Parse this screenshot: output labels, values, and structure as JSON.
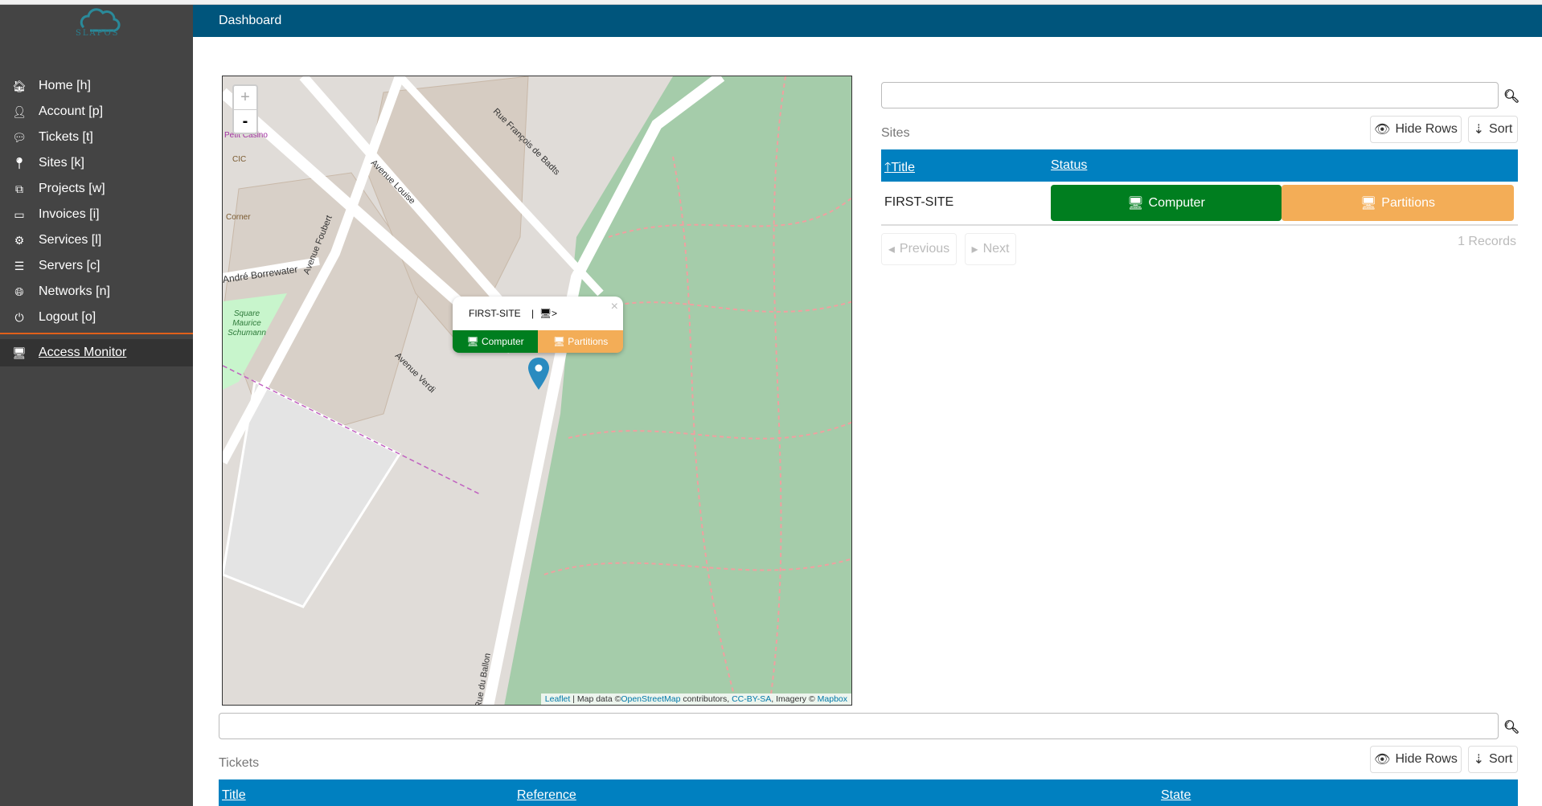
{
  "app": {
    "logo_text": "SLAPOS",
    "header_title": "Dashboard"
  },
  "sidebar": {
    "items": [
      {
        "label": "Home [h]",
        "icon": "home-icon"
      },
      {
        "label": "Account [p]",
        "icon": "user-icon"
      },
      {
        "label": "Tickets [t]",
        "icon": "comments-icon"
      },
      {
        "label": "Sites [k]",
        "icon": "map-marker-icon"
      },
      {
        "label": "Projects [w]",
        "icon": "cubes-icon"
      },
      {
        "label": "Invoices [i]",
        "icon": "credit-card-icon"
      },
      {
        "label": "Services [l]",
        "icon": "cogs-icon"
      },
      {
        "label": "Servers [c]",
        "icon": "database-icon"
      },
      {
        "label": "Networks [n]",
        "icon": "globe-icon"
      },
      {
        "label": "Logout [o]",
        "icon": "power-icon"
      }
    ],
    "access_monitor": "Access Monitor"
  },
  "map": {
    "zoom_in": "+",
    "zoom_out": "-",
    "popup": {
      "title": "FIRST-SITE",
      "separator": "|",
      "link": ">",
      "close": "×",
      "computer": "Computer",
      "partitions": "Partitions"
    },
    "attribution": {
      "leaflet": "Leaflet",
      "sep": " | Map data ©",
      "osm": "OpenStreetMap",
      "contrib": " contributors, ",
      "license": "CC-BY-SA",
      "imagery": ", Imagery © ",
      "mapbox": "Mapbox"
    },
    "labels": [
      "Avenue Louise",
      "Avenue Foubert",
      "Avenue Verdi",
      "Rue François de Badts",
      "André Borrewater",
      "Square Maurice Schumann",
      "Petit Casino",
      "CIC",
      "Corner",
      "Rue du Ballon"
    ]
  },
  "sites": {
    "search_value": "",
    "search_placeholder": "",
    "label": "Sites",
    "hide_rows": "Hide Rows",
    "sort": "Sort",
    "columns": [
      "Title",
      "Status"
    ],
    "rows": [
      {
        "title": "FIRST-SITE",
        "computer": "Computer",
        "partitions": "Partitions"
      }
    ],
    "previous": "Previous",
    "next": "Next",
    "records": "1 Records"
  },
  "tickets": {
    "search_value": "",
    "search_placeholder": "",
    "label": "Tickets",
    "hide_rows": "Hide Rows",
    "sort": "Sort",
    "columns": [
      "Title",
      "Reference",
      "State"
    ]
  },
  "colors": {
    "header": "#00557c",
    "sidebar": "#444444",
    "table_header": "#0080c0",
    "computer": "#007e1f",
    "partitions": "#f3ad57",
    "accent": "#e0601a"
  }
}
